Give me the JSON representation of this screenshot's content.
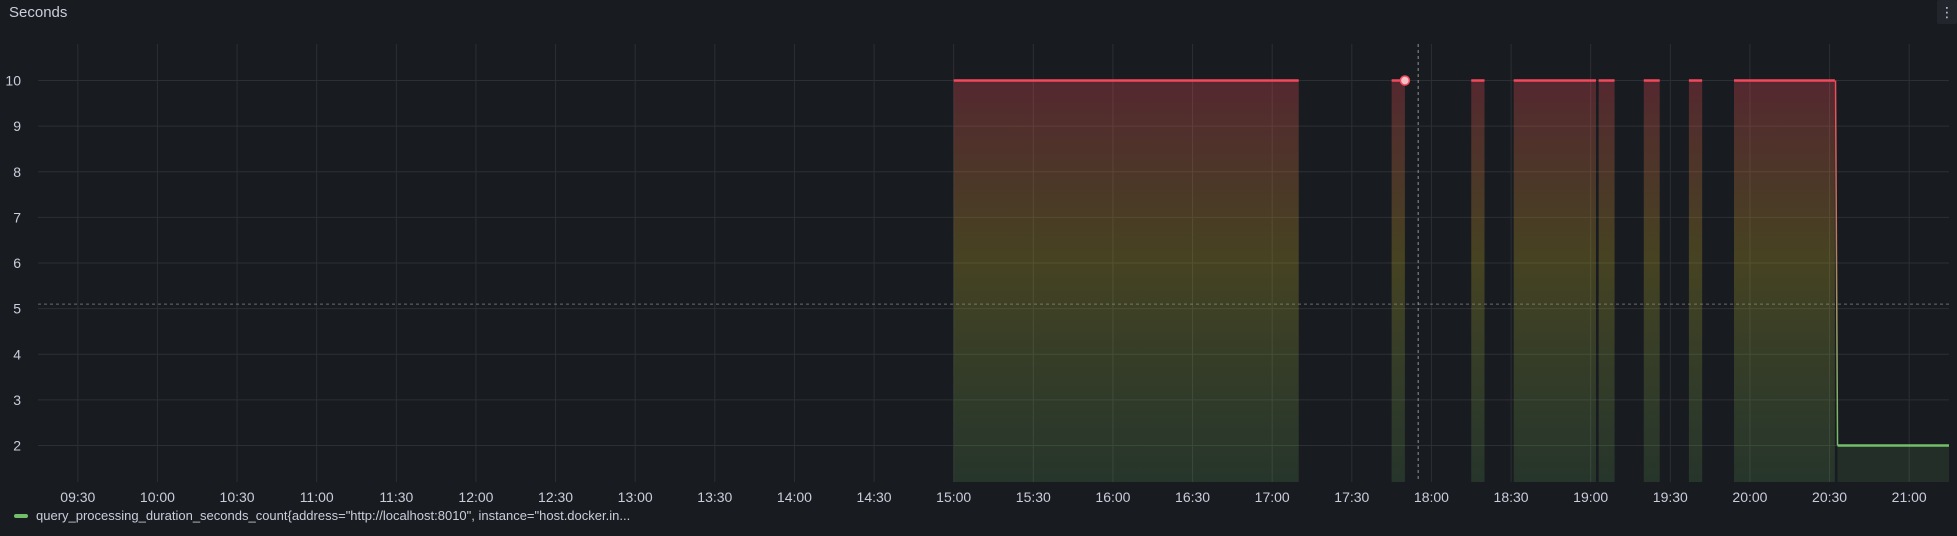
{
  "panel": {
    "title": "Seconds",
    "menu_icon": "vertical-dots-icon"
  },
  "colors": {
    "background": "#181b1f",
    "grid": "#2c2f35",
    "high": "#f2495c",
    "low": "#73bf69",
    "axis_text": "#ccccdc"
  },
  "chart_data": {
    "type": "area",
    "title": "Seconds",
    "xlabel": "",
    "ylabel": "",
    "x_ticks": [
      "09:30",
      "10:00",
      "10:30",
      "11:00",
      "11:30",
      "12:00",
      "12:30",
      "13:00",
      "13:30",
      "14:00",
      "14:30",
      "15:00",
      "15:30",
      "16:00",
      "16:30",
      "17:00",
      "17:30",
      "18:00",
      "18:30",
      "19:00",
      "19:30",
      "20:00",
      "20:30",
      "21:00"
    ],
    "y_ticks": [
      2,
      3,
      4,
      5,
      6,
      7,
      8,
      9,
      10
    ],
    "xlim": [
      "09:15",
      "21:15"
    ],
    "ylim": [
      1.2,
      10.8
    ],
    "grid": true,
    "legend_position": "bottom-left",
    "threshold_line": 5.1,
    "hover_time": "17:55",
    "hover_point": {
      "x": "17:50",
      "y": 10
    },
    "series": [
      {
        "name": "query_processing_duration_seconds_count{address=\"http://localhost:8010\", instance=\"host.docker.in...",
        "segments": [
          {
            "start": "15:00",
            "end": "17:10",
            "value": 10
          },
          {
            "start": "17:45",
            "end": "17:50",
            "value": 10
          },
          {
            "start": "18:15",
            "end": "18:20",
            "value": 10
          },
          {
            "start": "18:31",
            "end": "19:02",
            "value": 10
          },
          {
            "start": "19:03",
            "end": "19:09",
            "value": 10
          },
          {
            "start": "19:20",
            "end": "19:26",
            "value": 10
          },
          {
            "start": "19:37",
            "end": "19:42",
            "value": 10
          },
          {
            "start": "19:54",
            "end": "20:32",
            "value": 10
          },
          {
            "start": "20:33",
            "end": "21:15",
            "value": 2
          }
        ]
      }
    ]
  },
  "legend": {
    "label": "query_processing_duration_seconds_count{address=\"http://localhost:8010\", instance=\"host.docker.in..."
  }
}
